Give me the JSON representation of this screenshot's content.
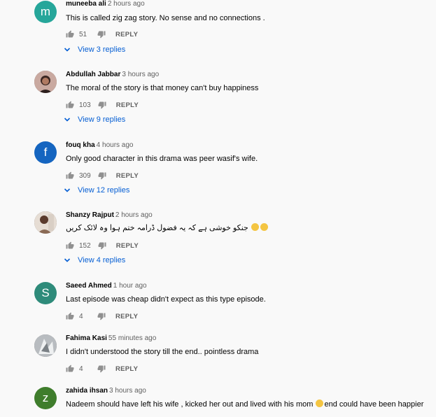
{
  "comments": [
    {
      "author": "muneeba ali",
      "time": "2 hours ago",
      "text": "This is called zig zag  story. No sense and no connections .",
      "likes": "51",
      "reply_label": "REPLY",
      "replies_label": "View 3 replies",
      "avatar_letter": "m",
      "avatar_color": "#26a69a"
    },
    {
      "author": "Abdullah Jabbar",
      "time": "3 hours ago",
      "text": "The moral of the story is that money can't buy happiness",
      "likes": "103",
      "reply_label": "REPLY",
      "replies_label": "View 9 replies"
    },
    {
      "author": "fouq kha",
      "time": "4 hours ago",
      "text": "Only good character in this drama was peer wasif's wife.",
      "likes": "309",
      "reply_label": "REPLY",
      "replies_label": "View 12 replies",
      "avatar_letter": "f",
      "avatar_color": "#1565c0"
    },
    {
      "author": "Shanzy Rajput",
      "time": "2 hours ago",
      "text": "جنکو خوشی ہے کہ یہ فضول ڈرامہ ختم ہوا وہ لائک کریں",
      "likes": "152",
      "reply_label": "REPLY",
      "replies_label": "View 4 replies"
    },
    {
      "author": "Saeed Ahmed",
      "time": "1 hour ago",
      "text": "Last episode was cheap didn't expect as this type episode.",
      "likes": "4",
      "reply_label": "REPLY",
      "avatar_letter": "S",
      "avatar_color": "#2e8b7a"
    },
    {
      "author": "Fahima Kasi",
      "time": "55 minutes ago",
      "text": "I didn't understood the story till the end.. pointless drama",
      "likes": "4",
      "reply_label": "REPLY"
    },
    {
      "author": "zahida ihsan",
      "time": "3 hours ago",
      "text_before": "Nadeem should have left his wife , kicked her out and lived with his mom",
      "text_after": "end could have been happier",
      "avatar_letter": "z",
      "avatar_color": "#3f7d2c"
    }
  ]
}
